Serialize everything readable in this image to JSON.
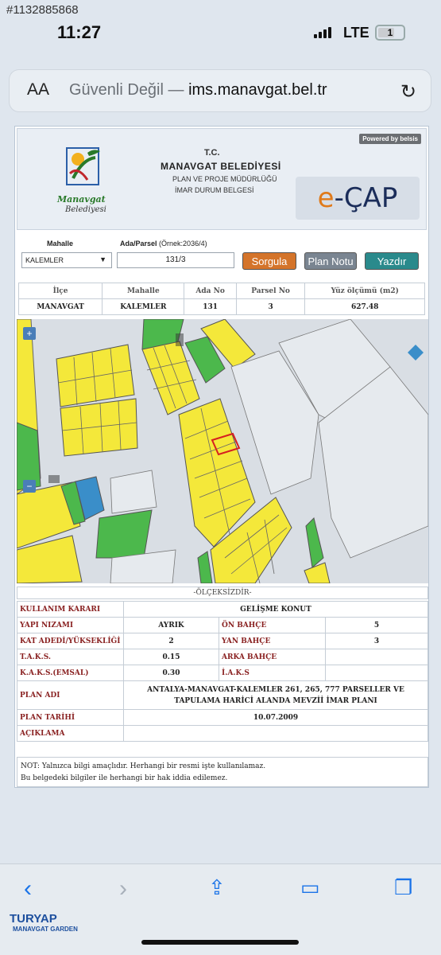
{
  "watermark": "#1132885868",
  "status": {
    "time": "11:27",
    "network": "LTE",
    "battery": "1"
  },
  "browser": {
    "text_size": "AA",
    "insecure_label": "Güvenli Değil —",
    "domain": "ims.manavgat.bel.tr"
  },
  "header": {
    "logo_text": "Manavgat",
    "logo_sub": "Belediyesi",
    "tc": "T.C.",
    "org": "MANAVGAT BELEDİYESİ",
    "dept": "PLAN VE PROJE MÜDÜRLÜĞÜ",
    "doc": "İMAR DURUM BELGESİ",
    "powered": "Powered by belsis",
    "product": "e-ÇAP"
  },
  "form": {
    "mahalle_label": "Mahalle",
    "ada_label": "Ada/Parsel",
    "ada_hint": "(Örnek:2036/4)",
    "mahalle_value": "KALEMLER",
    "parsel_value": "131/3",
    "sorgula": "Sorgula",
    "plan_notu": "Plan Notu",
    "yazdir": "Yazdır"
  },
  "info": {
    "headers": [
      "İlçe",
      "Mahalle",
      "Ada No",
      "Parsel No",
      "Yüz ölçümü (m2)"
    ],
    "values": [
      "MANAVGAT",
      "KALEMLER",
      "131",
      "3",
      "627.48"
    ]
  },
  "scale_text": "-ÖLÇEKSİZDİR-",
  "properties": {
    "kullanim_label": "KULLANIM KARARI",
    "kullanim": "GELİŞME KONUT",
    "yapi_label": "YAPI NIZAMI",
    "yapi": "AYRIK",
    "on_bahce_label": "ÖN BAHÇE",
    "on_bahce": "5",
    "kat_label": "KAT ADEDİ/YÜKSEKLİĞİ",
    "kat": "2",
    "yan_bahce_label": "YAN BAHÇE",
    "yan_bahce": "3",
    "taks_label": "T.A.K.S.",
    "taks": "0.15",
    "arka_bahce_label": "ARKA BAHÇE",
    "arka_bahce": "",
    "kaks_label": "K.A.K.S.(EMSAL)",
    "kaks": "0.30",
    "iaks_label": "İ.A.K.S",
    "iaks": "",
    "plan_adi_label": "PLAN ADI",
    "plan_adi": "ANTALYA-MANAVGAT-KALEMLER 261, 265, 777 PARSELLER VE TAPULAMA HARİCİ ALANDA MEVZİİ İMAR PLANI",
    "plan_tarihi_label": "PLAN TARİHİ",
    "plan_tarihi": "10.07.2009",
    "aciklama_label": "AÇIKLAMA",
    "aciklama": ""
  },
  "note": {
    "line1": "NOT: Yalnızca bilgi amaçlıdır. Herhangi bir resmi işte kullanılamaz.",
    "line2": "Bu belgedeki bilgiler ile herhangi bir hak iddia edilemez."
  },
  "branding": {
    "name": "TURYAP",
    "sub": "MANAVGAT GARDEN"
  },
  "colors": {
    "accent": "#1a73e8",
    "sorgula": "#d4742a",
    "yazdir": "#2a8a8c",
    "plan_yellow": "#f4e83a",
    "plan_green": "#4cb84c"
  }
}
